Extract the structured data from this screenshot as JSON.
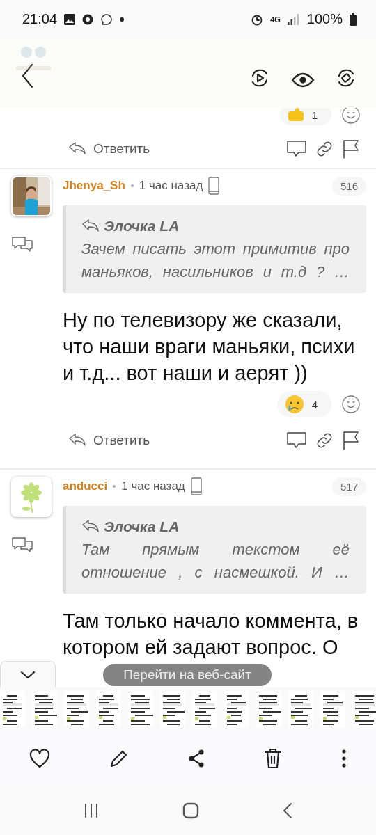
{
  "status_bar": {
    "time": "21:04",
    "network": "4G",
    "battery": "100%"
  },
  "top_comment": {
    "reaction": {
      "kind": "thumbs_up",
      "count": "1"
    },
    "reply": "Ответить"
  },
  "comments": [
    {
      "author": "Jhenya_Sh",
      "time": "1 час назад",
      "number": "516",
      "quote_author": "Элочка LA",
      "quote": "Зачем писать этот примитив про маньяков, насильников и т.д ? …",
      "body": "Ну по телевизору же сказали, что наши враги маньяки, психи и т.д... вот наши и аерят ))",
      "reaction": {
        "kind": "crying",
        "count": "4"
      },
      "reply": "Ответить"
    },
    {
      "author": "anducci",
      "avatar": {
        "kind": "flower"
      },
      "time": "1 час назад",
      "number": "517",
      "quote_author": "Элочка LA",
      "quote": "Там прямым текстом её отношение , с насмешкой. И …",
      "body": "Там только начало коммента, в котором ей задают вопрос. О"
    }
  ],
  "toast": "Перейти на веб-сайт"
}
